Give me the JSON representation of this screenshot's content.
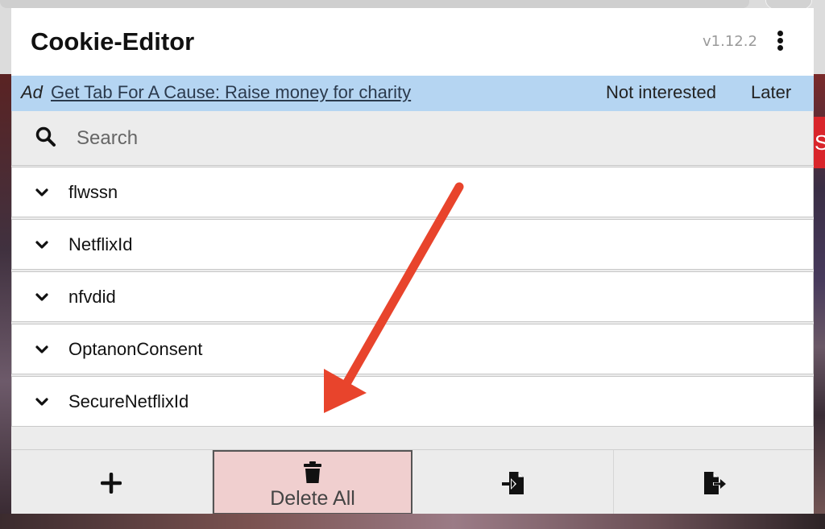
{
  "header": {
    "title": "Cookie-Editor",
    "version": "v1.12.2",
    "menu_icon": "more-vertical-icon"
  },
  "ad": {
    "tag": "Ad",
    "link_text": "Get Tab For A Cause: Raise money for charity",
    "not_interested": "Not interested",
    "later": "Later"
  },
  "search": {
    "placeholder": "Search",
    "value": "",
    "icon": "search-icon"
  },
  "cookies": [
    {
      "name": "flwssn"
    },
    {
      "name": "NetflixId"
    },
    {
      "name": "nfvdid"
    },
    {
      "name": "OptanonConsent"
    },
    {
      "name": "SecureNetflixId"
    }
  ],
  "toolbar": {
    "add_icon": "plus-icon",
    "delete_label": "Delete All",
    "delete_icon": "trash-icon",
    "import_icon": "file-import-icon",
    "export_icon": "file-export-icon"
  },
  "background": {
    "partial_text": "S"
  },
  "colors": {
    "ad_bar": "#b5d5f2",
    "delete_highlight": "#f0cfcf",
    "annotation_arrow": "#e8442c"
  }
}
